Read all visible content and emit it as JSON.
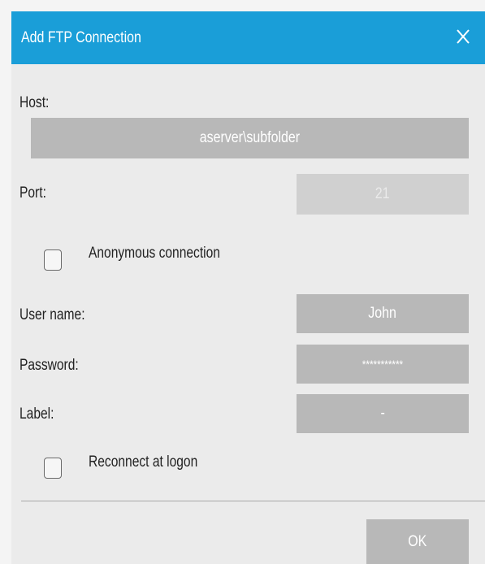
{
  "dialog": {
    "title": "Add FTP Connection",
    "close_icon": "close-icon",
    "accent_color": "#1a9ed8"
  },
  "form": {
    "host_label": "Host:",
    "host_value": "aserver\\subfolder",
    "port_label": "Port:",
    "port_value": "21",
    "anonymous_label": "Anonymous connection",
    "anonymous_checked": false,
    "username_label": "User name:",
    "username_value": "John",
    "password_label": "Password:",
    "password_value": "***********",
    "label_label": "Label:",
    "label_value": "-",
    "reconnect_label": "Reconnect at logon",
    "reconnect_checked": false
  },
  "footer": {
    "ok_label": "OK"
  }
}
